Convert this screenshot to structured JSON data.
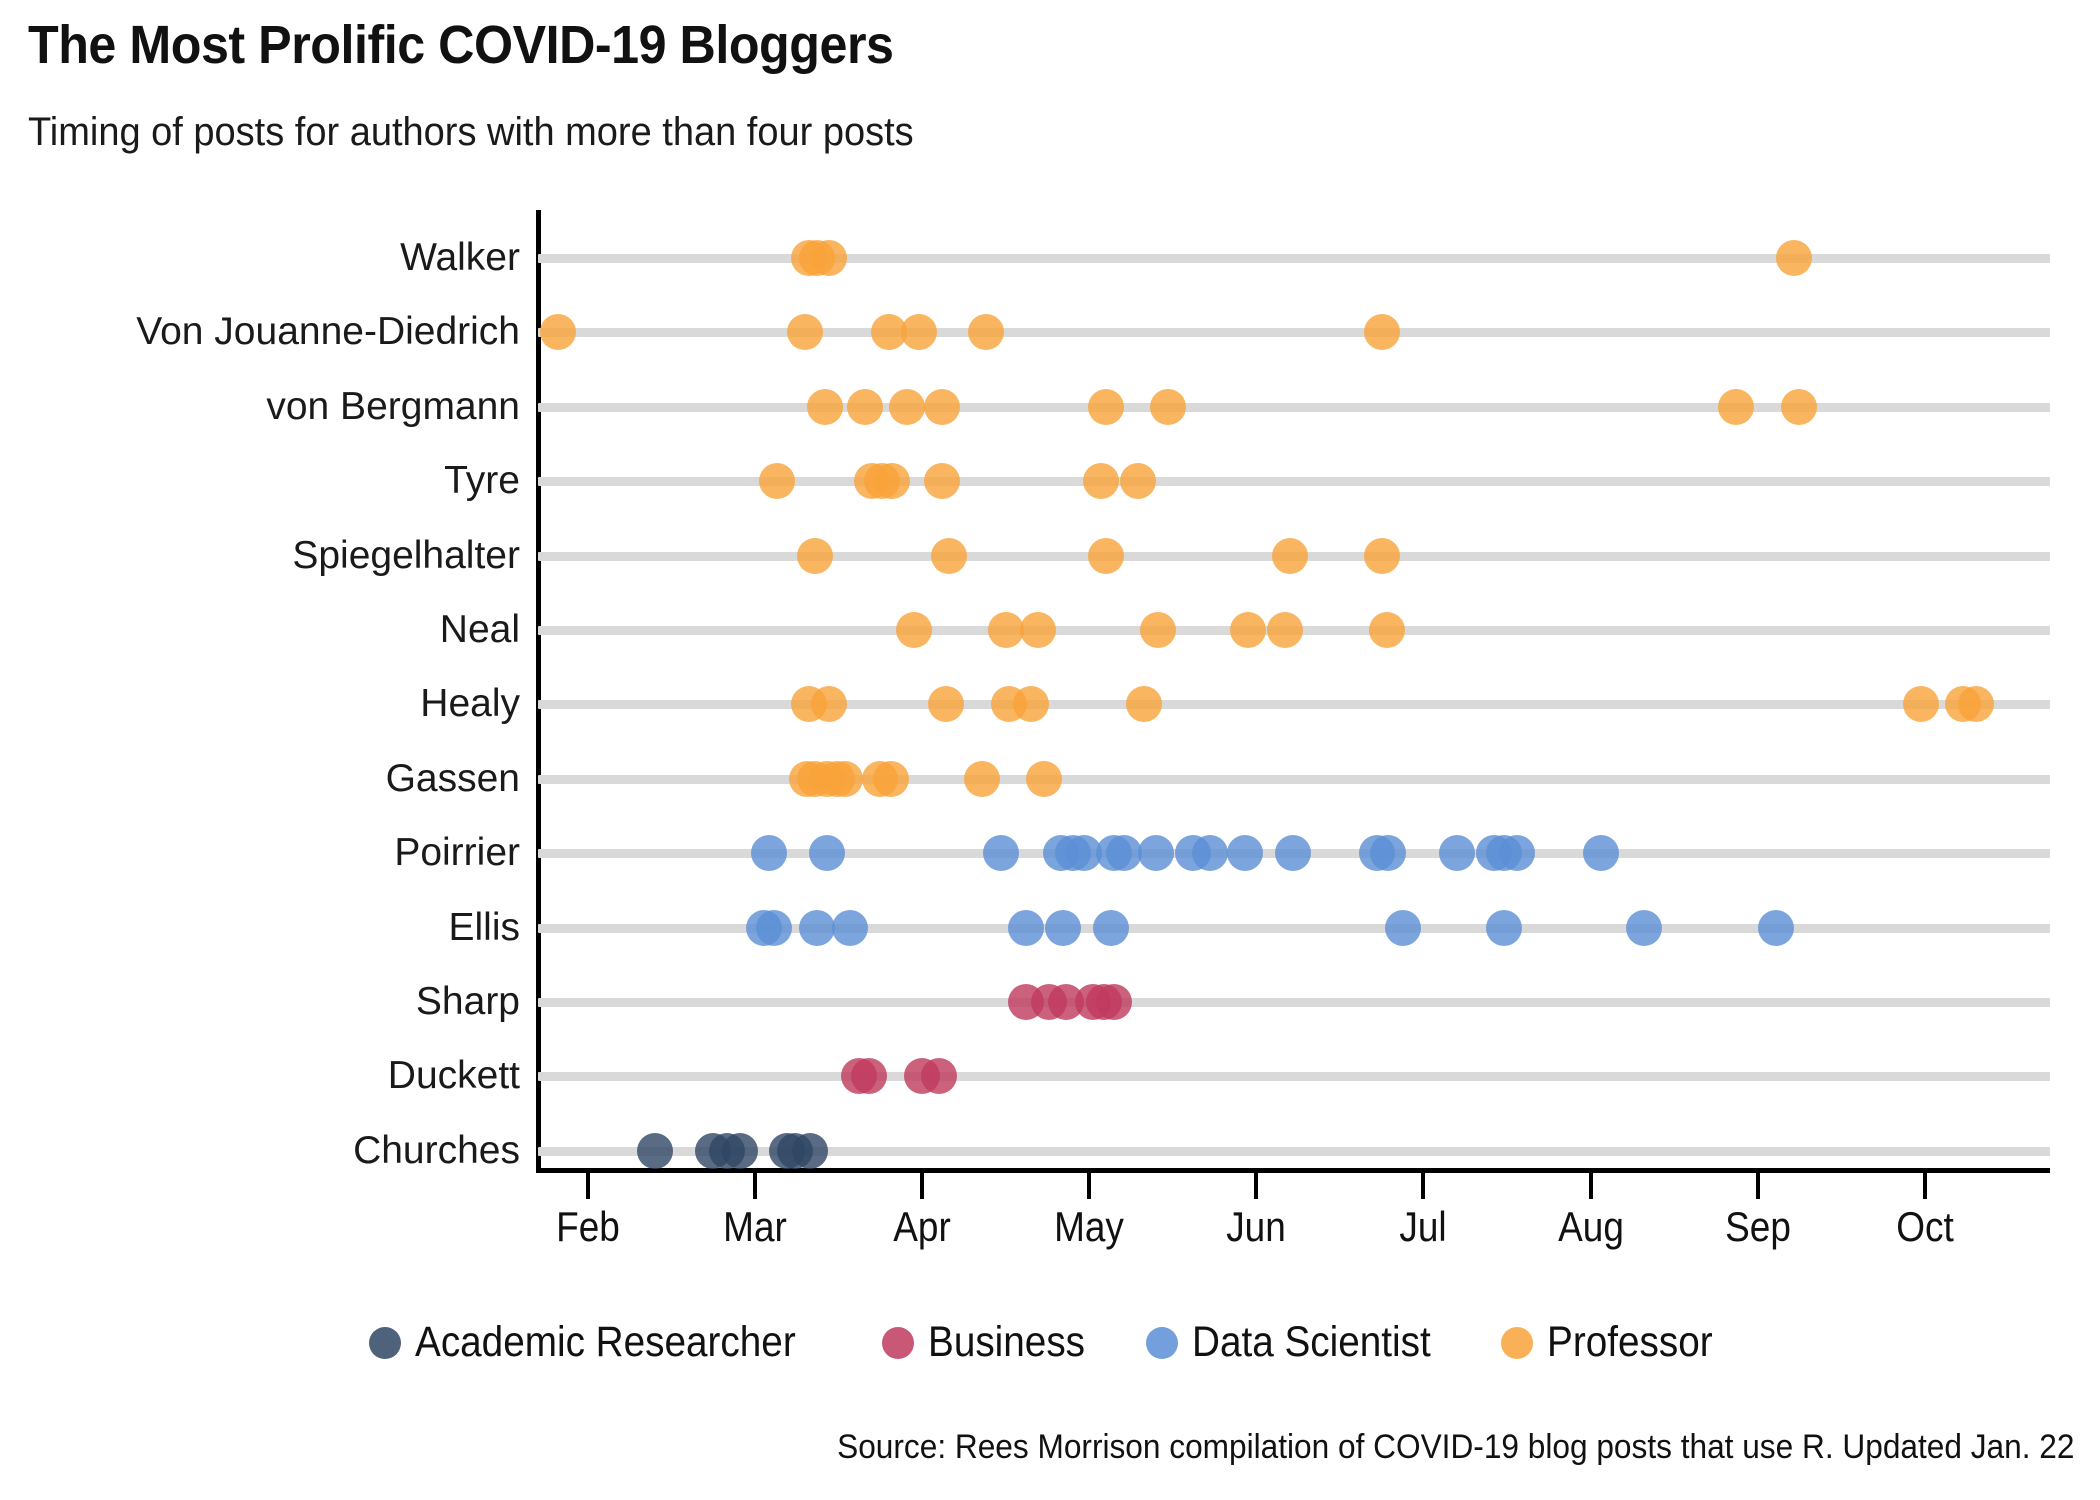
{
  "header": {
    "title": "The Most Prolific COVID-19 Bloggers",
    "subtitle": "Timing of posts for authors with more than four posts"
  },
  "footer": {
    "source": "Source: Rees Morrison compilation of COVID-19 blog posts that use R. Updated Jan. 22"
  },
  "colors": {
    "academic_researcher": "#2f4764",
    "business": "#bf3a5e",
    "data_scientist": "#5b8ed6",
    "professor": "#f9a23a",
    "gridline": "#d9d9d9",
    "axis": "#000000",
    "text": "#1a1a1a"
  },
  "chart_data": {
    "type": "scatter",
    "title": "The Most Prolific COVID-19 Bloggers",
    "subtitle": "Timing of posts for authors with more than four posts",
    "xlabel": "",
    "ylabel": "",
    "grid": true,
    "legend_position": "bottom",
    "x_axis": {
      "type": "time",
      "tick_labels": [
        "Feb",
        "Mar",
        "Apr",
        "May",
        "Jun",
        "Jul",
        "Aug",
        "Sep",
        "Oct"
      ],
      "tick_months": [
        2,
        3,
        4,
        5,
        6,
        7,
        8,
        9,
        10
      ],
      "range_months": [
        1.7,
        10.75
      ],
      "year": 2020
    },
    "y_axis": {
      "categories": [
        "Walker",
        "Von Jouanne-Diedrich",
        "von Bergmann",
        "Tyre",
        "Spiegelhalter",
        "Neal",
        "Healy",
        "Gassen",
        "Poirrier",
        "Ellis",
        "Sharp",
        "Duckett",
        "Churches"
      ]
    },
    "legend": [
      {
        "label": "Academic Researcher",
        "color": "#2f4764"
      },
      {
        "label": "Business",
        "color": "#bf3a5e"
      },
      {
        "label": "Data Scientist",
        "color": "#5b8ed6"
      },
      {
        "label": "Professor",
        "color": "#f9a23a"
      }
    ],
    "series": [
      {
        "name": "Walker",
        "category": "Professor",
        "color": "#f9a23a",
        "x_months": [
          3.32,
          3.37,
          3.44,
          9.22
        ]
      },
      {
        "name": "Von Jouanne-Diedrich",
        "category": "Professor",
        "color": "#f9a23a",
        "x_months": [
          1.82,
          3.3,
          3.8,
          3.98,
          4.38,
          6.75
        ]
      },
      {
        "name": "von Bergmann",
        "category": "Professor",
        "color": "#f9a23a",
        "x_months": [
          3.42,
          3.66,
          3.91,
          4.12,
          5.1,
          5.47,
          8.87,
          9.25
        ]
      },
      {
        "name": "Tyre",
        "category": "Professor",
        "color": "#f9a23a",
        "x_months": [
          3.13,
          3.7,
          3.76,
          3.82,
          4.12,
          5.07,
          5.29
        ]
      },
      {
        "name": "Spiegelhalter",
        "category": "Professor",
        "color": "#f9a23a",
        "x_months": [
          3.36,
          4.16,
          5.1,
          6.2,
          6.75
        ]
      },
      {
        "name": "Neal",
        "category": "Professor",
        "color": "#f9a23a",
        "x_months": [
          3.95,
          4.5,
          4.69,
          5.41,
          5.95,
          6.17,
          6.78
        ]
      },
      {
        "name": "Healy",
        "category": "Professor",
        "color": "#f9a23a",
        "x_months": [
          3.32,
          3.44,
          4.14,
          4.52,
          4.65,
          5.33,
          9.98,
          10.23,
          10.31
        ]
      },
      {
        "name": "Gassen",
        "category": "Professor",
        "color": "#f9a23a",
        "x_months": [
          3.31,
          3.36,
          3.43,
          3.49,
          3.54,
          3.75,
          3.81,
          4.36,
          4.73
        ]
      },
      {
        "name": "Poirrier",
        "category": "Data Scientist",
        "color": "#5b8ed6",
        "x_months": [
          3.08,
          3.43,
          4.47,
          4.83,
          4.9,
          4.97,
          5.15,
          5.21,
          5.4,
          5.62,
          5.72,
          5.93,
          6.22,
          6.72,
          6.79,
          7.2,
          7.42,
          7.48,
          7.56,
          8.06
        ]
      },
      {
        "name": "Ellis",
        "category": "Data Scientist",
        "color": "#5b8ed6",
        "x_months": [
          3.05,
          3.11,
          3.37,
          3.57,
          4.62,
          4.84,
          5.13,
          6.88,
          7.48,
          8.32,
          9.11
        ]
      },
      {
        "name": "Sharp",
        "category": "Business",
        "color": "#bf3a5e",
        "x_months": [
          4.62,
          4.76,
          4.86,
          5.02,
          5.09,
          5.15
        ]
      },
      {
        "name": "Duckett",
        "category": "Business",
        "color": "#bf3a5e",
        "x_months": [
          3.62,
          3.68,
          4.0,
          4.1
        ]
      },
      {
        "name": "Churches",
        "category": "Academic Researcher",
        "color": "#2f4764",
        "x_months": [
          2.4,
          2.75,
          2.83,
          2.91,
          3.19,
          3.24,
          3.33
        ]
      }
    ]
  }
}
